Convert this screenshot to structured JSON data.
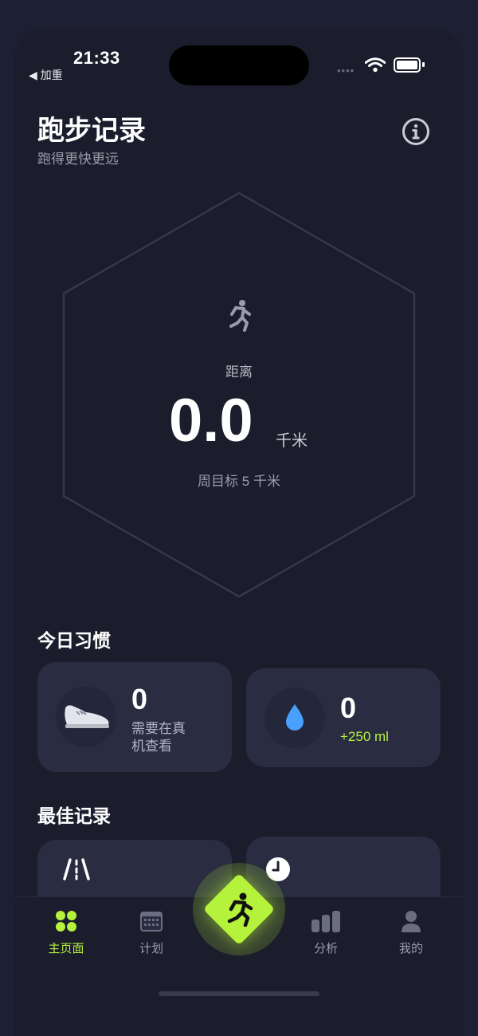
{
  "status_bar": {
    "time": "21:33",
    "back_label": "◀ 加重",
    "signal": "••••"
  },
  "header": {
    "title": "跑步记录",
    "subtitle": "跑得更快更远"
  },
  "distance": {
    "label": "距离",
    "value": "0.0",
    "unit": "千米",
    "weekly_goal": "周目标 5 千米"
  },
  "habits": {
    "section_title": "今日习惯",
    "steps": {
      "value": "0",
      "desc_line1": "需要在真",
      "desc_line2": "机查看",
      "icon": "shoe-icon"
    },
    "water": {
      "value": "0",
      "add": "+250 ml",
      "icon": "water-drop-icon"
    }
  },
  "records": {
    "section_title": "最佳记录"
  },
  "tabs": [
    {
      "label": "主页面",
      "icon": "grid-icon",
      "active": true
    },
    {
      "label": "计划",
      "icon": "calendar-icon",
      "active": false
    },
    {
      "label": "",
      "icon": "run-icon",
      "active": false
    },
    {
      "label": "分析",
      "icon": "bar-chart-icon",
      "active": false
    },
    {
      "label": "我的",
      "icon": "person-icon",
      "active": false
    }
  ],
  "colors": {
    "accent": "#b5f23c",
    "background": "#1b1d2c",
    "card": "#2a2d41",
    "water": "#4aa0ff"
  }
}
